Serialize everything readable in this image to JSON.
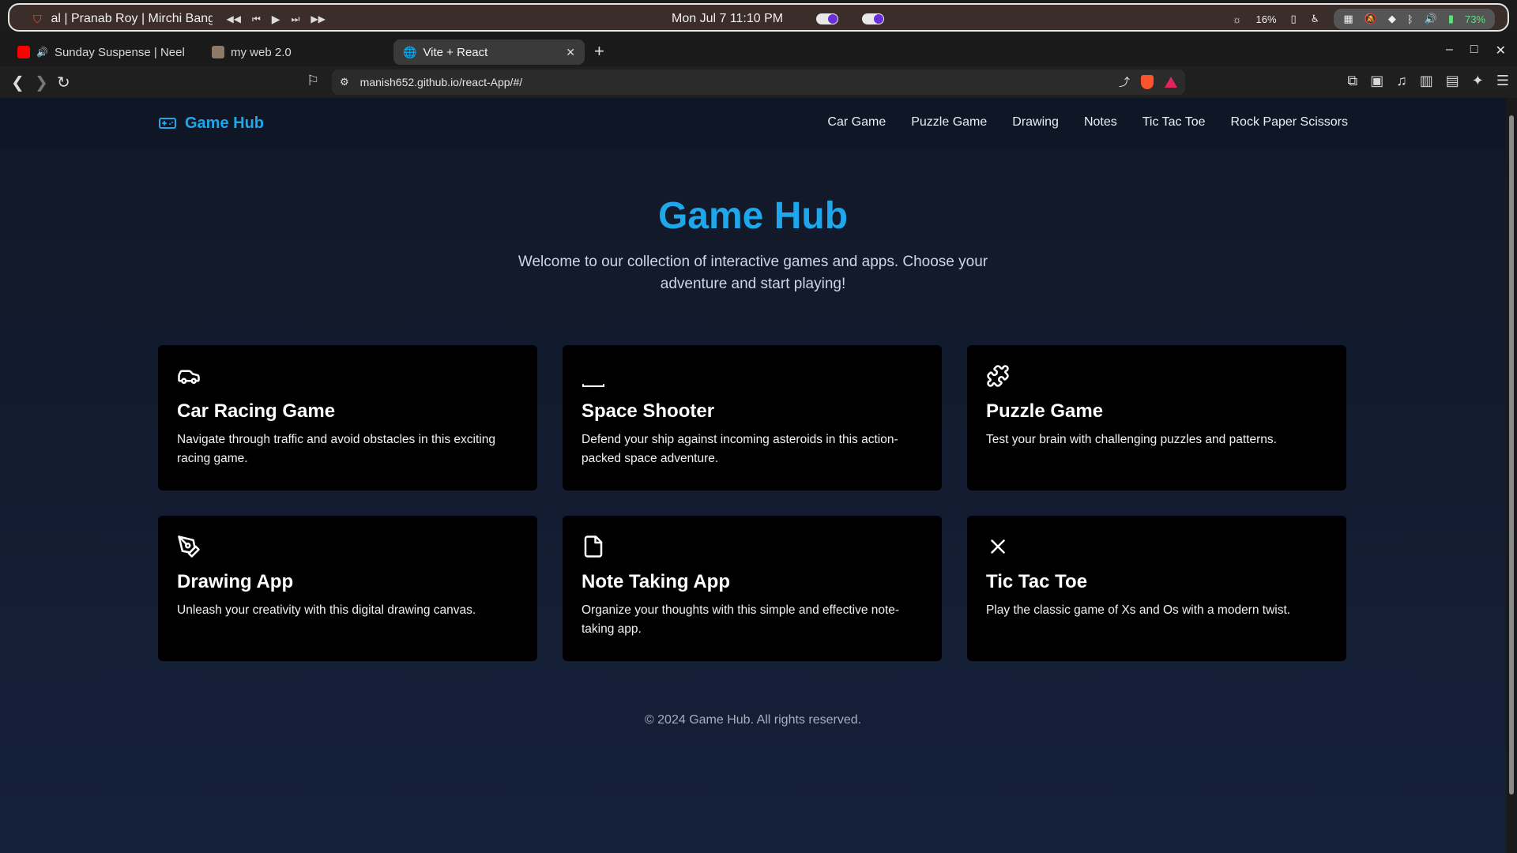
{
  "system_bar": {
    "media_title": "al | Pranab Roy | Mirchi Bang",
    "clock": "Mon Jul 7  11:10 PM",
    "brightness": "16%",
    "battery": "73%"
  },
  "tabs": [
    {
      "label": "Sunday Suspense | Neel",
      "active": false
    },
    {
      "label": "my web 2.0",
      "active": false
    },
    {
      "label": "Vite + React",
      "active": true
    }
  ],
  "address_bar": {
    "url": "manish652.github.io/react-App/#/"
  },
  "navbar": {
    "brand": "Game Hub",
    "links": [
      "Car Game",
      "Puzzle Game",
      "Drawing",
      "Notes",
      "Tic Tac Toe",
      "Rock Paper Scissors"
    ]
  },
  "hero": {
    "title": "Game Hub",
    "subtitle": "Welcome to our collection of interactive games and apps. Choose your adventure and start playing!"
  },
  "cards": [
    {
      "title": "Car Racing Game",
      "desc": "Navigate through traffic and avoid obstacles in this exciting racing game.",
      "icon": "car-icon"
    },
    {
      "title": "Space Shooter",
      "desc": "Defend your ship against incoming asteroids in this action-packed space adventure.",
      "icon": "rocket-icon"
    },
    {
      "title": "Puzzle Game",
      "desc": "Test your brain with challenging puzzles and patterns.",
      "icon": "puzzle-icon"
    },
    {
      "title": "Drawing App",
      "desc": "Unleash your creativity with this digital drawing canvas.",
      "icon": "pen-tool-icon"
    },
    {
      "title": "Note Taking App",
      "desc": "Organize your thoughts with this simple and effective note-taking app.",
      "icon": "note-icon"
    },
    {
      "title": "Tic Tac Toe",
      "desc": "Play the classic game of Xs and Os with a modern twist.",
      "icon": "x-icon"
    }
  ],
  "footer": {
    "text": "© 2024 Game Hub. All rights reserved."
  },
  "colors": {
    "accent": "#1ea7ea",
    "background": "#111827",
    "card": "#000000"
  }
}
